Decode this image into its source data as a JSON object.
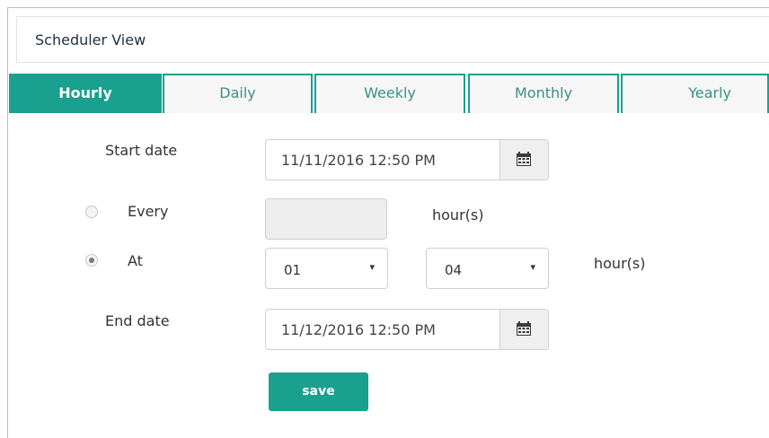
{
  "header": {
    "title": "Scheduler View"
  },
  "tabs": [
    {
      "label": "Hourly",
      "active": true
    },
    {
      "label": "Daily",
      "active": false
    },
    {
      "label": "Weekly",
      "active": false
    },
    {
      "label": "Monthly",
      "active": false
    },
    {
      "label": "Yearly",
      "active": false
    }
  ],
  "form": {
    "start_date_label": "Start date",
    "start_date_value": "11/11/2016 12:50 PM",
    "every_label": "Every",
    "every_value": "",
    "every_unit": "hour(s)",
    "at_label": "At",
    "at_hour_value": "01",
    "at_minute_value": "04",
    "at_unit": "hour(s)",
    "end_date_label": "End date",
    "end_date_value": "11/12/2016 12:50 PM",
    "selected_mode": "At",
    "save_label": "save"
  },
  "icons": {
    "calendar": "calendar-icon",
    "caret": "▾"
  },
  "colors": {
    "accent": "#1aa08f"
  }
}
